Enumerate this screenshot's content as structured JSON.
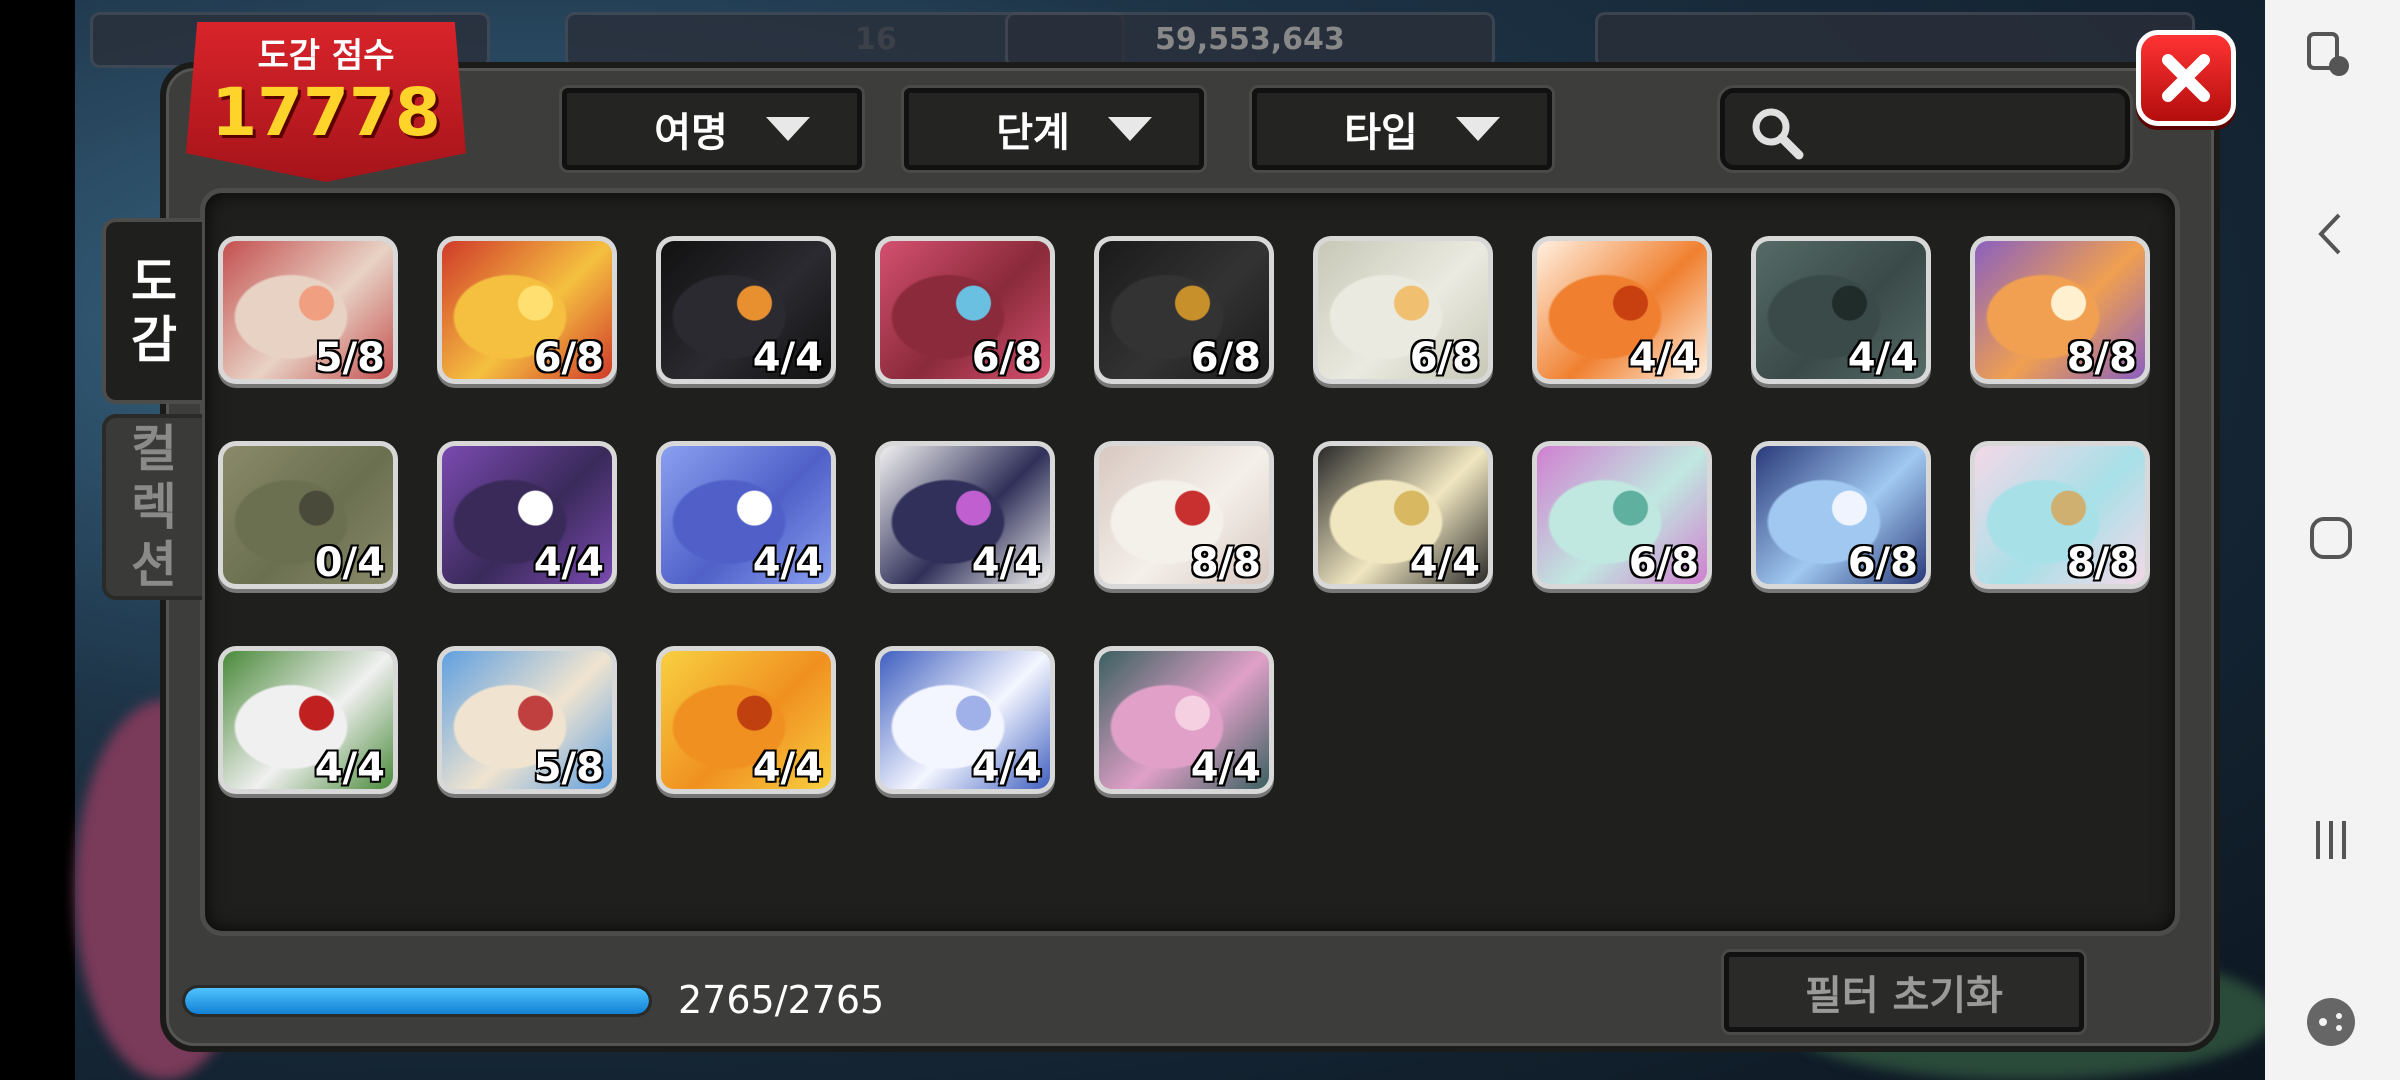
{
  "score": {
    "label": "도감 점수",
    "value": "17778"
  },
  "filters": [
    {
      "label": "여명"
    },
    {
      "label": "단계"
    },
    {
      "label": "타입"
    }
  ],
  "search": {
    "placeholder": ""
  },
  "tabs": [
    {
      "label": "도\n감",
      "active": true
    },
    {
      "label": "컬\n렉\n션",
      "active": false
    }
  ],
  "cards": [
    {
      "count": "5/8",
      "palette": [
        "#e8d2c4",
        "#c45050",
        "#f0a080"
      ]
    },
    {
      "count": "6/8",
      "palette": [
        "#f5c040",
        "#d03a2a",
        "#ffdf70"
      ]
    },
    {
      "count": "4/4",
      "palette": [
        "#2a2a30",
        "#111",
        "#e89030"
      ]
    },
    {
      "count": "6/8",
      "palette": [
        "#8a2a3a",
        "#d45070",
        "#6ac0e0"
      ]
    },
    {
      "count": "6/8",
      "palette": [
        "#333",
        "#1a1a1a",
        "#c8902a"
      ]
    },
    {
      "count": "6/8",
      "palette": [
        "#eaeae0",
        "#c8c8b8",
        "#f0c070"
      ]
    },
    {
      "count": "4/4",
      "palette": [
        "#f08030",
        "#fff0e0",
        "#c84010"
      ]
    },
    {
      "count": "4/4",
      "palette": [
        "#3a4a48",
        "#556a66",
        "#202c2a"
      ]
    },
    {
      "count": "8/8",
      "palette": [
        "#f0a050",
        "#8a60c0",
        "#fff0d0"
      ]
    },
    {
      "count": "0/4",
      "palette": [
        "#6a7050",
        "#8a8a6a",
        "#4a4a3a"
      ]
    },
    {
      "count": "4/4",
      "palette": [
        "#3a2a5a",
        "#7a4ab0",
        "#fff"
      ]
    },
    {
      "count": "4/4",
      "palette": [
        "#5060c8",
        "#8aa0f0",
        "#fff"
      ]
    },
    {
      "count": "4/4",
      "palette": [
        "#30305a",
        "#f0f0f0",
        "#c060d0"
      ]
    },
    {
      "count": "8/8",
      "palette": [
        "#f4f0ea",
        "#d8c8c0",
        "#c83030"
      ]
    },
    {
      "count": "4/4",
      "palette": [
        "#f0e6c0",
        "#2a2a2a",
        "#d8b860"
      ]
    },
    {
      "count": "6/8",
      "palette": [
        "#c0e8e0",
        "#d080d0",
        "#60b0a0"
      ]
    },
    {
      "count": "6/8",
      "palette": [
        "#a0c8f0",
        "#2a3a7a",
        "#f0f4ff"
      ]
    },
    {
      "count": "8/8",
      "palette": [
        "#a8e0e8",
        "#f4d8e8",
        "#d0b070"
      ]
    },
    {
      "count": "4/4",
      "palette": [
        "#f0f0f0",
        "#4a8a3a",
        "#c02020"
      ]
    },
    {
      "count": "5/8",
      "palette": [
        "#f0e4d0",
        "#60a0e0",
        "#c04040"
      ]
    },
    {
      "count": "4/4",
      "palette": [
        "#f09020",
        "#f8d040",
        "#c04010"
      ]
    },
    {
      "count": "4/4",
      "palette": [
        "#f4f6ff",
        "#4060c0",
        "#a0b0e8"
      ]
    },
    {
      "count": "4/4",
      "palette": [
        "#e0a0c8",
        "#3a6060",
        "#f4d0e0"
      ]
    }
  ],
  "progress": {
    "text": "2765/2765",
    "fraction": 1.0
  },
  "reset_label": "필터 초기화",
  "hud": {
    "left_value": "16",
    "right_value": "59,553,643"
  },
  "colors": {
    "accent": "#d8242a",
    "score": "#ffd42a",
    "progress": "#2a9ae8"
  }
}
